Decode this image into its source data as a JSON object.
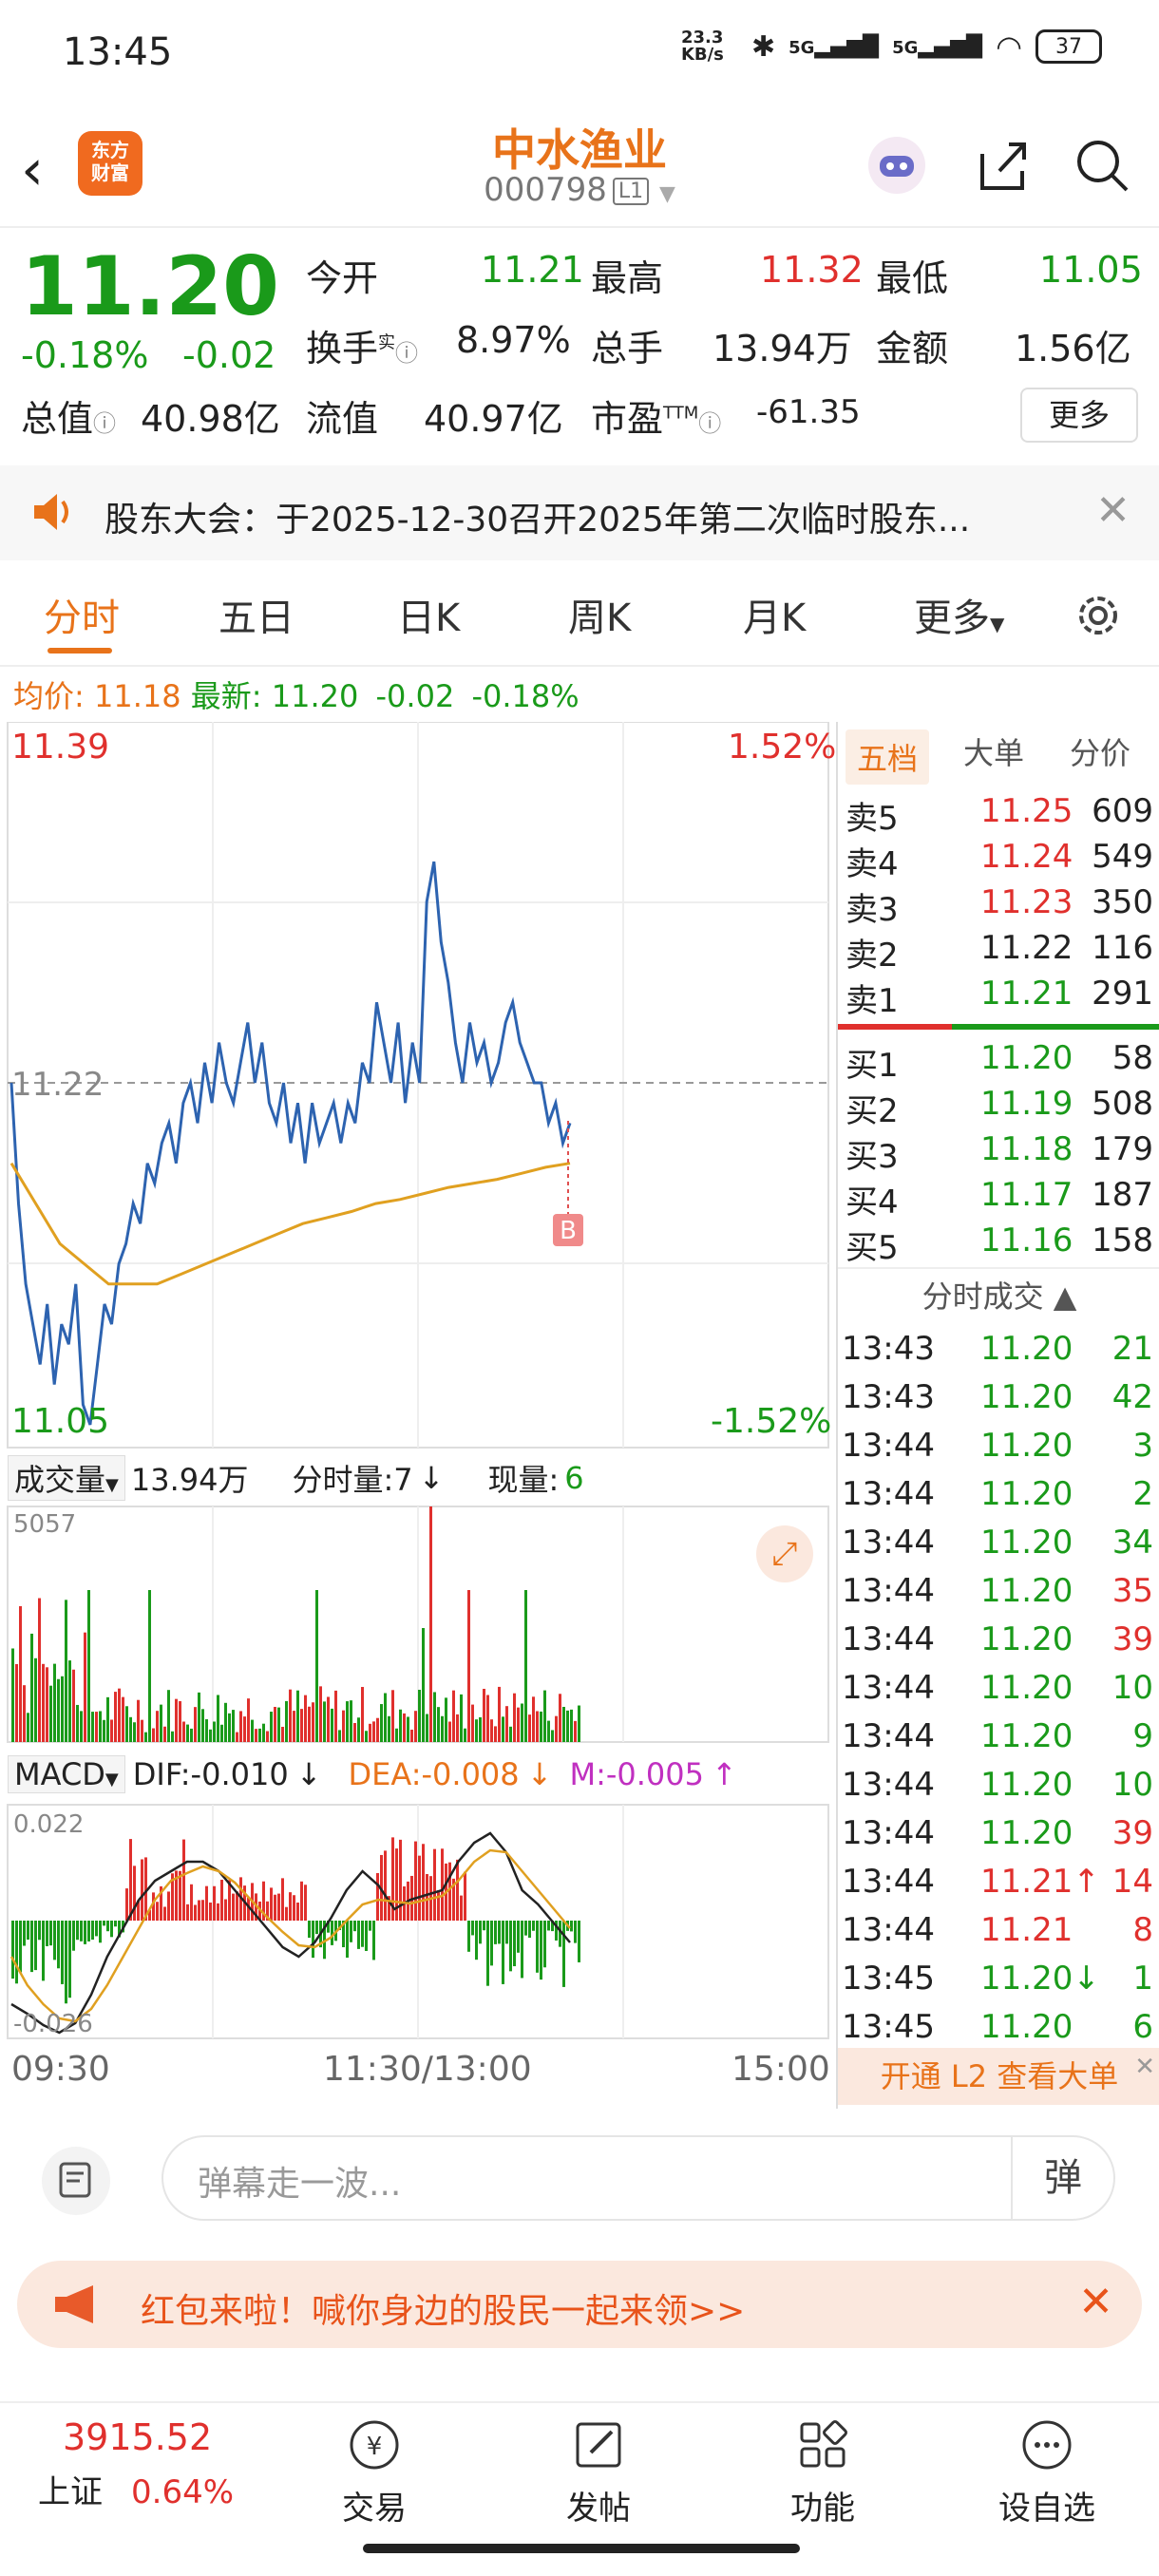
{
  "status_bar": {
    "time": "13:45",
    "net_speed": "23.3 KB/s",
    "signal1": "5G",
    "signal2": "5G",
    "battery": "37"
  },
  "header": {
    "stock_name": "中水渔业",
    "stock_code": "000798",
    "level_badge": "L1",
    "logo_text_1": "东方",
    "logo_text_2": "财富"
  },
  "quote": {
    "price": "11.20",
    "change_pct": "-0.18%",
    "change": "-0.02",
    "open_label": "今开",
    "open": "11.21",
    "high_label": "最高",
    "high": "11.32",
    "low_label": "最低",
    "low": "11.05",
    "turnover_label": "换手",
    "turnover_sup": "实",
    "turnover": "8.97%",
    "volume_label": "总手",
    "volume": "13.94万",
    "amount_label": "金额",
    "amount": "1.56亿",
    "mktcap_label": "总值",
    "mktcap": "40.98亿",
    "float_label": "流值",
    "float": "40.97亿",
    "pe_label": "市盈",
    "pe_sup": "TTM",
    "pe": "-61.35",
    "more_label": "更多"
  },
  "notice": {
    "text": "股东大会：于2025-12-30召开2025年第二次临时股东..."
  },
  "tabs": [
    "分时",
    "五日",
    "日K",
    "周K",
    "月K",
    "更多"
  ],
  "avg_line": {
    "avg_label": "均价:",
    "avg": "11.18",
    "latest_label": "最新:",
    "latest": "11.20",
    "chg": "-0.02",
    "pct": "-0.18%"
  },
  "price_chart": {
    "top_price": "11.39",
    "top_pct": "1.52%",
    "mid_price": "11.22",
    "bottom_price": "11.05",
    "bottom_pct": "-1.52%",
    "marker": "B"
  },
  "volume_header": {
    "label": "成交量",
    "total": "13.94万",
    "tick_label": "分时量:7",
    "now_label": "现量:",
    "now": "6",
    "max": "5057"
  },
  "macd_header": {
    "label": "MACD",
    "dif": "DIF:-0.010",
    "dea": "DEA:-0.008",
    "m": "M:-0.005",
    "top": "0.022",
    "bottom": "-0.026"
  },
  "x_axis": {
    "start": "09:30",
    "mid": "11:30/13:00",
    "end": "15:00"
  },
  "right_panel": {
    "tabs": [
      "五档",
      "大单",
      "分价"
    ],
    "sell": [
      {
        "label": "卖5",
        "price": "11.25",
        "vol": "609"
      },
      {
        "label": "卖4",
        "price": "11.24",
        "vol": "549"
      },
      {
        "label": "卖3",
        "price": "11.23",
        "vol": "350"
      },
      {
        "label": "卖2",
        "price": "11.22",
        "vol": "116"
      },
      {
        "label": "卖1",
        "price": "11.21",
        "vol": "291"
      }
    ],
    "buy": [
      {
        "label": "买1",
        "price": "11.20",
        "vol": "58"
      },
      {
        "label": "买2",
        "price": "11.19",
        "vol": "508"
      },
      {
        "label": "买3",
        "price": "11.18",
        "vol": "179"
      },
      {
        "label": "买4",
        "price": "11.17",
        "vol": "187"
      },
      {
        "label": "买5",
        "price": "11.16",
        "vol": "158"
      }
    ],
    "trades_title": "分时成交",
    "trades": [
      {
        "time": "13:43",
        "price": "11.20",
        "vol": "21",
        "dir": "green"
      },
      {
        "time": "13:43",
        "price": "11.20",
        "vol": "42",
        "dir": "green"
      },
      {
        "time": "13:44",
        "price": "11.20",
        "vol": "3",
        "dir": "green"
      },
      {
        "time": "13:44",
        "price": "11.20",
        "vol": "2",
        "dir": "green"
      },
      {
        "time": "13:44",
        "price": "11.20",
        "vol": "34",
        "dir": "green"
      },
      {
        "time": "13:44",
        "price": "11.20",
        "vol": "35",
        "dir": "red"
      },
      {
        "time": "13:44",
        "price": "11.20",
        "vol": "39",
        "dir": "red"
      },
      {
        "time": "13:44",
        "price": "11.20",
        "vol": "10",
        "dir": "green"
      },
      {
        "time": "13:44",
        "price": "11.20",
        "vol": "9",
        "dir": "green"
      },
      {
        "time": "13:44",
        "price": "11.20",
        "vol": "10",
        "dir": "green"
      },
      {
        "time": "13:44",
        "price": "11.20",
        "vol": "39",
        "dir": "red"
      },
      {
        "time": "13:44",
        "price": "11.21↑",
        "vol": "14",
        "dir": "red"
      },
      {
        "time": "13:44",
        "price": "11.21",
        "vol": "8",
        "dir": "red"
      },
      {
        "time": "13:45",
        "price": "11.20↓",
        "vol": "1",
        "dir": "green"
      },
      {
        "time": "13:45",
        "price": "11.20",
        "vol": "6",
        "dir": "green"
      }
    ],
    "l2_banner": "开通 L2 查看大单"
  },
  "danmu": {
    "placeholder": "弹幕走一波...",
    "button": "弹"
  },
  "redpacket": {
    "text": "红包来啦！喊你身边的股民一起来领>>"
  },
  "bottom_nav": {
    "index_value": "3915.52",
    "index_name": "上证",
    "index_pct": "0.64%",
    "items": [
      "交易",
      "发帖",
      "功能",
      "设自选"
    ]
  },
  "colors": {
    "accent": "#e8731a",
    "up": "#e0302d",
    "down": "#1a9a1a",
    "price_line": "#2d63b0",
    "avg_line": "#e0a020"
  }
}
